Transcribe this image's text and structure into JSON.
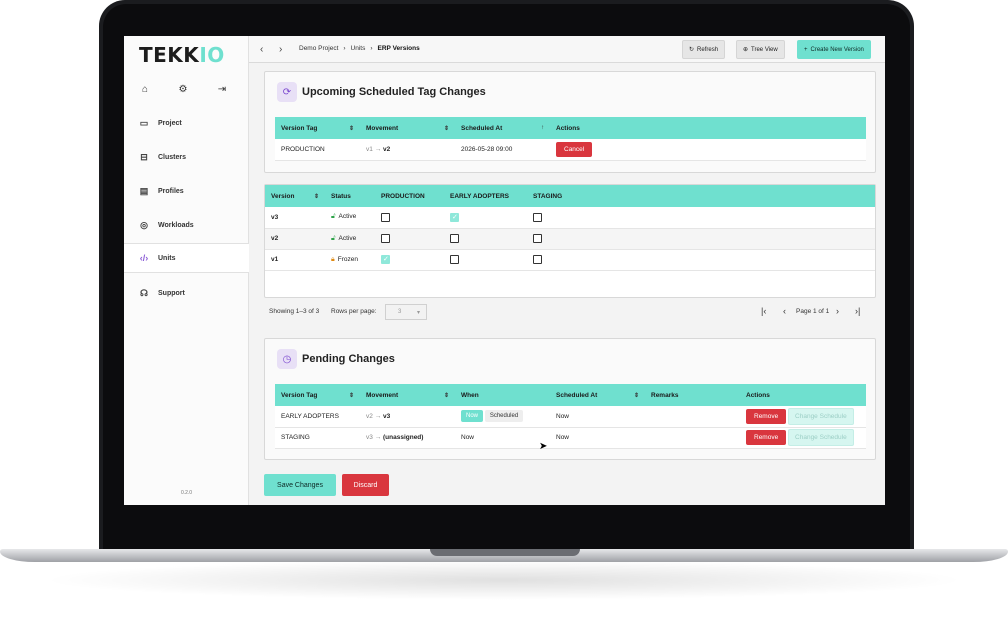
{
  "app": {
    "logo_text_a": "TEKK",
    "logo_text_b": "IO",
    "version": "0.2.0",
    "accent_color": "#6fe0cf",
    "danger_color": "#d9363e"
  },
  "sidebar": {
    "quick_icons": [
      "home-icon",
      "gear-icon",
      "logout-icon"
    ],
    "items": [
      {
        "label": "Project",
        "icon": "folder-icon"
      },
      {
        "label": "Clusters",
        "icon": "server-icon"
      },
      {
        "label": "Profiles",
        "icon": "file-icon"
      },
      {
        "label": "Workloads",
        "icon": "workload-icon"
      },
      {
        "label": "Units",
        "icon": "code-icon",
        "active": true
      },
      {
        "label": "Support",
        "icon": "headset-icon"
      }
    ]
  },
  "topbar": {
    "breadcrumb": [
      "Demo Project",
      "Units",
      "ERP Versions"
    ],
    "refresh_label": "Refresh",
    "tree_view_label": "Tree View",
    "create_label": "Create New Version"
  },
  "scheduled": {
    "title": "Upcoming Scheduled Tag Changes",
    "columns": [
      "Version Tag",
      "Movement",
      "Scheduled At",
      "Actions"
    ],
    "rows": [
      {
        "tag": "PRODUCTION",
        "from": "v1",
        "to": "v2",
        "scheduled_at": "2026-05-28 09:00",
        "action": "Cancel"
      }
    ]
  },
  "versions": {
    "columns": [
      "Version",
      "Status",
      "PRODUCTION",
      "EARLY ADOPTERS",
      "STAGING"
    ],
    "rows": [
      {
        "version": "v3",
        "status": "Active",
        "production": false,
        "early_adopters": true,
        "staging": false
      },
      {
        "version": "v2",
        "status": "Active",
        "production": false,
        "early_adopters": false,
        "staging": false
      },
      {
        "version": "v1",
        "status": "Frozen",
        "production": true,
        "early_adopters": false,
        "staging": false
      }
    ],
    "pager": {
      "showing": "Showing 1–3 of 3",
      "rows_per_page_label": "Rows per page:",
      "rows_per_page": "3",
      "page_label": "Page 1 of 1"
    }
  },
  "pending": {
    "title": "Pending Changes",
    "columns": [
      "Version Tag",
      "Movement",
      "When",
      "Scheduled At",
      "Remarks",
      "Actions"
    ],
    "rows": [
      {
        "tag": "EARLY ADOPTERS",
        "from": "v2",
        "to": "v3",
        "when": "",
        "now_label": "Now",
        "scheduled_label": "Scheduled",
        "scheduled_at": "Now",
        "remarks": "",
        "remove": "Remove",
        "change": "Change Schedule"
      },
      {
        "tag": "STAGING",
        "from": "v3",
        "to": "(unassigned)",
        "when": "Now",
        "scheduled_at": "Now",
        "remarks": "",
        "remove": "Remove",
        "change": "Change Schedule"
      }
    ]
  },
  "footer_actions": {
    "save_label": "Save Changes",
    "discard_label": "Discard"
  }
}
